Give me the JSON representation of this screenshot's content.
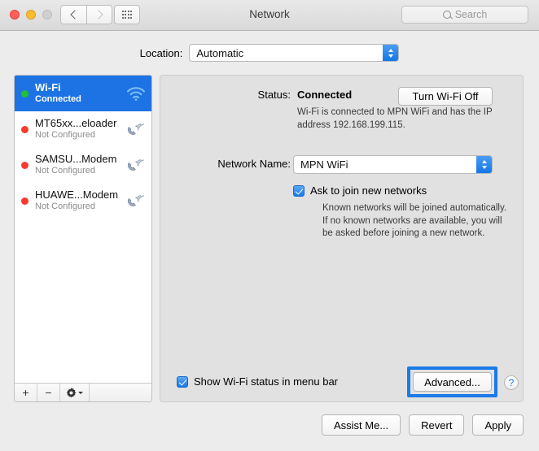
{
  "window": {
    "title": "Network",
    "traffic_lights": [
      "close",
      "minimize",
      "zoom"
    ],
    "nav": {
      "back": "back-arrow",
      "forward": "forward-arrow",
      "grid": "all-preferences-grid"
    },
    "search": {
      "placeholder": "Search",
      "value": ""
    }
  },
  "location": {
    "label": "Location:",
    "value": "Automatic"
  },
  "sidebar": {
    "services": [
      {
        "name": "Wi-Fi",
        "status": "Connected",
        "dot": "green",
        "icon": "wifi-icon",
        "selected": true
      },
      {
        "name": "MT65xx...eloader",
        "status": "Not Configured",
        "dot": "red",
        "icon": "modem-icon",
        "selected": false
      },
      {
        "name": "SAMSU...Modem",
        "status": "Not Configured",
        "dot": "red",
        "icon": "modem-icon",
        "selected": false
      },
      {
        "name": "HUAWE...Modem",
        "status": "Not Configured",
        "dot": "red",
        "icon": "modem-icon",
        "selected": false
      }
    ],
    "toolbar": {
      "add": "+",
      "remove": "−",
      "actions": "gear-icon"
    }
  },
  "main": {
    "status_label": "Status:",
    "status_value": "Connected",
    "turn_off_button": "Turn Wi-Fi Off",
    "status_description": "Wi-Fi is connected to MPN WiFi and has the IP address 192.168.199.115.",
    "network_name_label": "Network Name:",
    "network_name_value": "MPN WiFi",
    "ask_join_label": "Ask to join new networks",
    "ask_join_checked": true,
    "ask_join_description": "Known networks will be joined automatically. If no known networks are available, you will be asked before joining a new network.",
    "show_status_label": "Show Wi-Fi status in menu bar",
    "show_status_checked": true,
    "advanced_button": "Advanced...",
    "help_button": "?"
  },
  "footer": {
    "assist": "Assist Me...",
    "revert": "Revert",
    "apply": "Apply"
  },
  "colors": {
    "accent": "#1a7ae8",
    "selection": "#1d73e3",
    "connected_dot": "#21c130",
    "not_configured_dot": "#f93a2f",
    "focus_ring": "#1a7ae8"
  }
}
